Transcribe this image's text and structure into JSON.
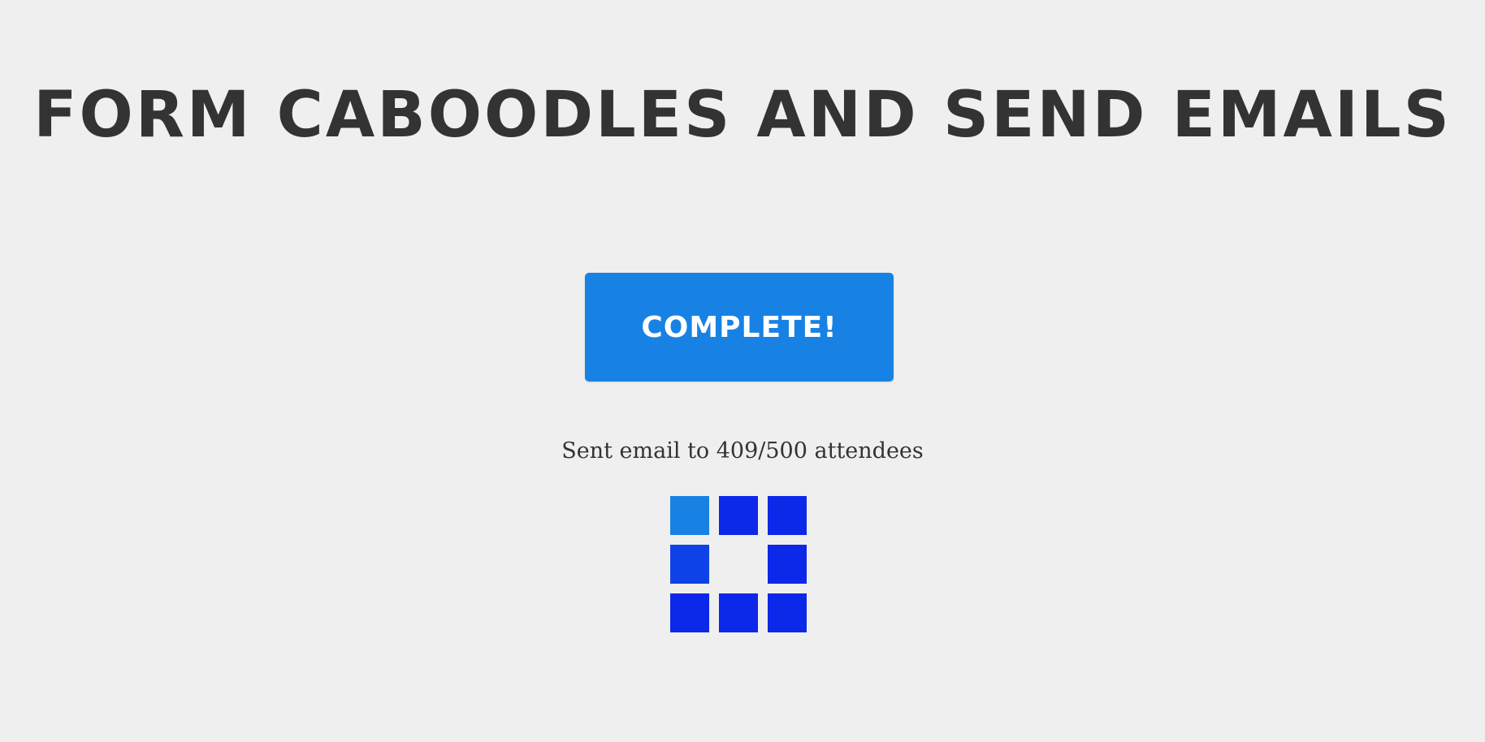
{
  "header": {
    "title": "FORM CABOODLES AND SEND EMAILS"
  },
  "action": {
    "button_label": "COMPLETE!"
  },
  "status": {
    "message": "Sent email to 409/500 attendees",
    "sent": 409,
    "total": 500
  },
  "colors": {
    "background": "#efeff0",
    "text": "#333333",
    "accent": "#1882e4",
    "loader_active": "#1882e4",
    "loader_mid": "#0d42e6",
    "loader_dark": "#0c28e8"
  },
  "loader": {
    "icon": "grid-spinner-icon",
    "cells": [
      {
        "name": "loader-cell-top-left",
        "tone": "loader_active"
      },
      {
        "name": "loader-cell-top-center",
        "tone": "loader_dark"
      },
      {
        "name": "loader-cell-top-right",
        "tone": "loader_dark"
      },
      {
        "name": "loader-cell-middle-left",
        "tone": "loader_mid"
      },
      {
        "name": "loader-cell-middle-right",
        "tone": "loader_dark"
      },
      {
        "name": "loader-cell-bottom-left",
        "tone": "loader_dark"
      },
      {
        "name": "loader-cell-bottom-center",
        "tone": "loader_dark"
      },
      {
        "name": "loader-cell-bottom-right",
        "tone": "loader_dark"
      }
    ]
  }
}
